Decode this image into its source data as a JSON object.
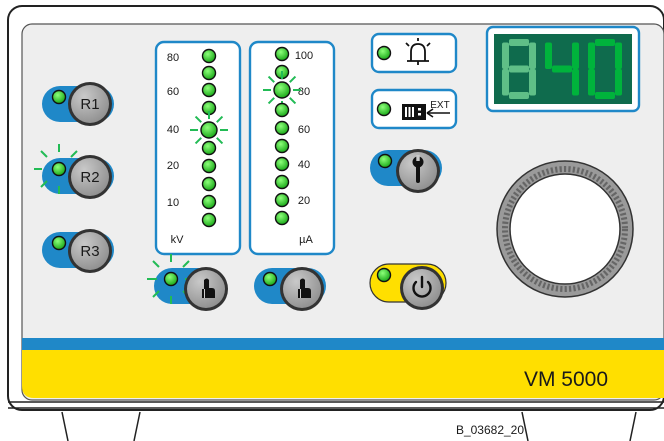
{
  "device": {
    "model": "VM 5000",
    "figure_id": "B_03682_20"
  },
  "colors": {
    "panel": "#eeeeee",
    "accent_blue": "#1f88c8",
    "accent_yellow": "#ffdf00",
    "led_green": "#1ec21e",
    "led_glow": "#22bb55",
    "display_bg": "#0f6b4d",
    "display_on": "#00b33c",
    "display_off": "#5fbf87",
    "knob_grey": "#9a9a9a"
  },
  "memory_buttons": [
    {
      "label": "R1",
      "led": "on"
    },
    {
      "label": "R2",
      "led": "blinking"
    },
    {
      "label": "R3",
      "led": "on"
    }
  ],
  "kv_scale": {
    "unit": "kV",
    "ticks": [
      "80",
      "60",
      "40",
      "20",
      "10"
    ],
    "active_led": "40"
  },
  "ua_scale": {
    "unit": "µA",
    "ticks": [
      "100",
      "80",
      "60",
      "40",
      "20"
    ],
    "active_led": "80"
  },
  "display": {
    "digits": [
      "8",
      "4",
      "0"
    ],
    "lit": [
      false,
      true,
      true
    ]
  },
  "indicators": {
    "alarm_icon": "alarm-bell-icon",
    "ext_label": "EXT"
  },
  "icons": {
    "service": "wrench-icon",
    "press_kv": "press-hand-icon",
    "press_ua": "press-hand-icon",
    "power": "power-icon"
  }
}
